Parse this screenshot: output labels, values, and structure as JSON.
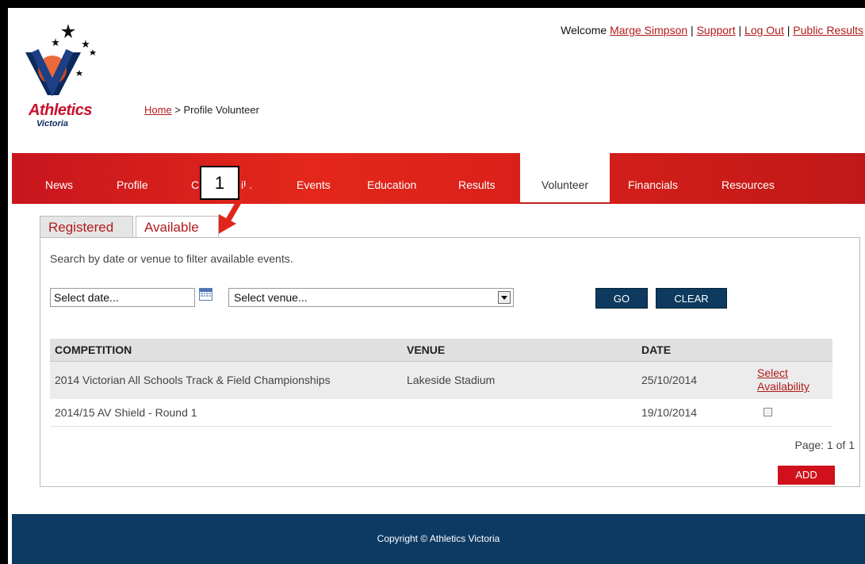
{
  "logo": {
    "text": "Athletics",
    "sub": "Victoria"
  },
  "topbar": {
    "welcome": "Welcome",
    "user": "Marge Simpson",
    "support": "Support",
    "logout": "Log Out",
    "public_results": "Public Results",
    "sep": "|"
  },
  "breadcrumb": {
    "home": "Home",
    "current": "> Profile Volunteer"
  },
  "nav": {
    "items": [
      "News",
      "Profile",
      "C",
      "ile",
      "Events",
      "Education",
      "Results",
      "Volunteer",
      "Financials",
      "Resources"
    ],
    "active": "Volunteer"
  },
  "annotation": {
    "number": "1"
  },
  "tabs": {
    "registered": "Registered",
    "available": "Available"
  },
  "panel": {
    "hint": "Search by date or venue to filter available events.",
    "date_placeholder": "Select date...",
    "venue_placeholder": "Select venue...",
    "go": "GO",
    "clear": "CLEAR"
  },
  "table": {
    "headers": [
      "COMPETITION",
      "VENUE",
      "DATE",
      ""
    ],
    "rows": [
      {
        "competition": "2014 Victorian All Schools Track & Field Championships",
        "venue": "Lakeside Stadium",
        "date": "25/10/2014",
        "action": "Select Availability"
      },
      {
        "competition": "2014/15 AV Shield - Round 1",
        "venue": "",
        "date": "19/10/2014",
        "action": ""
      }
    ],
    "page_info": "Page: 1 of 1",
    "add": "ADD"
  },
  "footer": {
    "copyright": "Copyright © Athletics Victoria"
  },
  "colors": {
    "accent_red": "#c8161e",
    "navy": "#0d3a63",
    "link_red": "#b01b1b"
  }
}
